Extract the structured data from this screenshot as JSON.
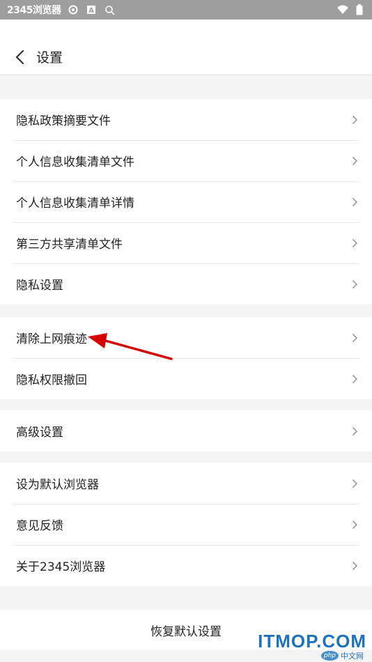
{
  "statusbar": {
    "app_name": "2345浏览器"
  },
  "header": {
    "title": "设置"
  },
  "groups": [
    {
      "items": [
        {
          "label": "隐私政策摘要文件"
        },
        {
          "label": "个人信息收集清单文件"
        },
        {
          "label": "个人信息收集清单详情"
        },
        {
          "label": "第三方共享清单文件"
        },
        {
          "label": "隐私设置"
        }
      ]
    },
    {
      "items": [
        {
          "label": "清除上网痕迹"
        },
        {
          "label": "隐私权限撤回"
        }
      ]
    },
    {
      "items": [
        {
          "label": "高级设置"
        }
      ]
    },
    {
      "items": [
        {
          "label": "设为默认浏览器"
        },
        {
          "label": "意见反馈"
        },
        {
          "label": "关于2345浏览器"
        }
      ]
    }
  ],
  "reset": {
    "label": "恢复默认设置"
  },
  "watermark": {
    "main": "ITMOP.COM",
    "badge": "php",
    "sub": "中文网"
  },
  "colors": {
    "arrow": "#d40000",
    "watermark": "#1e73be",
    "statusbar": "#9e9e9e"
  },
  "icons": [
    "back-arrow-icon",
    "chevron-right-icon",
    "wifi-icon",
    "battery-icon",
    "settings-icon",
    "a-icon",
    "search-icon"
  ]
}
